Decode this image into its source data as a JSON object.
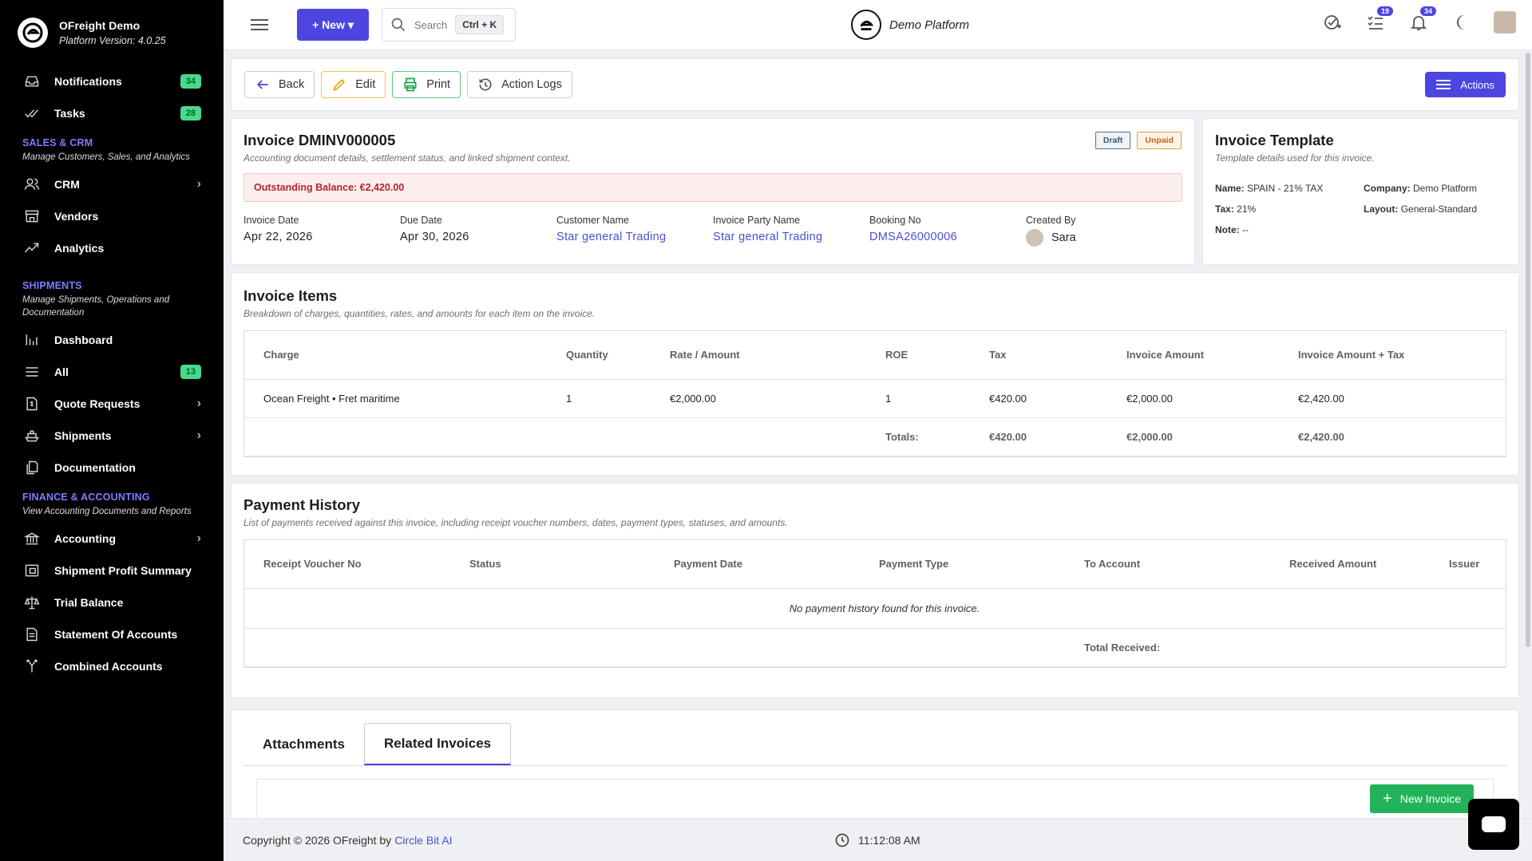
{
  "brand": {
    "title": "OFreight Demo",
    "version": "Platform Version: 4.0.25"
  },
  "sidebar": {
    "top": [
      {
        "label": "Notifications",
        "badge": "34"
      },
      {
        "label": "Tasks",
        "badge": "28"
      }
    ],
    "sales": {
      "title": "SALES & CRM",
      "sub": "Manage Customers, Sales, and Analytics",
      "items": [
        {
          "label": "CRM"
        },
        {
          "label": "Vendors"
        },
        {
          "label": "Analytics"
        }
      ]
    },
    "shipments": {
      "title": "SHIPMENTS",
      "sub": "Manage Shipments, Operations and Documentation",
      "items": [
        {
          "label": "Dashboard"
        },
        {
          "label": "All",
          "badge": "13"
        },
        {
          "label": "Quote Requests"
        },
        {
          "label": "Shipments"
        },
        {
          "label": "Documentation"
        }
      ]
    },
    "finance": {
      "title": "FINANCE & ACCOUNTING",
      "sub": "View Accounting Documents and Reports",
      "items": [
        {
          "label": "Accounting"
        },
        {
          "label": "Shipment Profit Summary"
        },
        {
          "label": "Trial Balance"
        },
        {
          "label": "Statement Of Accounts"
        },
        {
          "label": "Combined Accounts"
        }
      ]
    }
  },
  "topbar": {
    "new_label": "New",
    "search_label": "Search",
    "search_kbd": "Ctrl + K",
    "center_title": "Demo Platform",
    "tasks_count": "19",
    "notif_count": "34"
  },
  "toolbar": {
    "back": "Back",
    "edit": "Edit",
    "print": "Print",
    "logs": "Action Logs",
    "actions": "Actions"
  },
  "invoice": {
    "title": "Invoice DMINV000005",
    "subtitle": "Accounting document details, settlement status, and linked shipment context.",
    "status_draft": "Draft",
    "status_unpaid": "Unpaid",
    "balance": "Outstanding Balance: €2,420.00",
    "meta": [
      {
        "k": "Invoice Date",
        "v": "Apr 22, 2026"
      },
      {
        "k": "Due Date",
        "v": "Apr 30, 2026"
      },
      {
        "k": "Customer Name",
        "v": "Star general Trading"
      },
      {
        "k": "Invoice Party Name",
        "v": "Star general Trading"
      },
      {
        "k": "Booking No",
        "v": "DMSA26000006"
      },
      {
        "k": "Created By",
        "v": "Sara"
      }
    ]
  },
  "template": {
    "title": "Invoice Template",
    "subtitle": "Template details used for this invoice.",
    "name_k": "Name:",
    "name_v": "SPAIN - 21% TAX",
    "company_k": "Company:",
    "company_v": "Demo Platform",
    "tax_k": "Tax:",
    "tax_v": "21%",
    "layout_k": "Layout:",
    "layout_v": "General-Standard",
    "note_k": "Note:",
    "note_v": "--"
  },
  "items": {
    "title": "Invoice Items",
    "subtitle": "Breakdown of charges, quantities, rates, and amounts for each item on the invoice.",
    "headers": [
      "Charge",
      "Quantity",
      "Rate / Amount",
      "ROE",
      "Tax",
      "Invoice Amount",
      "Invoice Amount + Tax"
    ],
    "rows": [
      [
        "Ocean Freight • Fret maritime",
        "1",
        "€2,000.00",
        "1",
        "€420.00",
        "€2,000.00",
        "€2,420.00"
      ]
    ],
    "totals_label": "Totals:",
    "totals": [
      "€420.00",
      "€2,000.00",
      "€2,420.00"
    ]
  },
  "payments": {
    "title": "Payment History",
    "subtitle": "List of payments received against this invoice, including receipt voucher numbers, dates, payment types, statuses, and amounts.",
    "headers": [
      "Receipt Voucher No",
      "Status",
      "Payment Date",
      "Payment Type",
      "To Account",
      "Received Amount",
      "Issuer"
    ],
    "empty": "No payment history found for this invoice.",
    "total_label": "Total Received:"
  },
  "tabs": {
    "attachments": "Attachments",
    "related": "Related Invoices",
    "new_invoice": "New Invoice"
  },
  "footer": {
    "copyright": "Copyright © 2026 OFreight by",
    "link": "Circle Bit AI",
    "time": "11:12:08 AM"
  }
}
